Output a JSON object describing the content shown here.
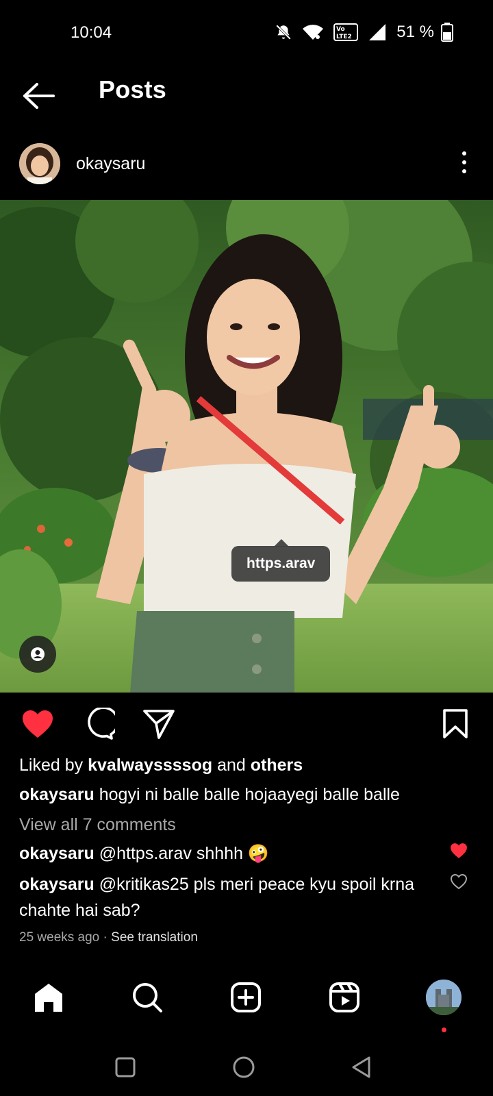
{
  "status_bar": {
    "time": "10:04",
    "battery_percent": "51 %",
    "icons": [
      "mute-icon",
      "wifi-icon",
      "volte-icon",
      "signal-icon",
      "battery-icon"
    ],
    "volte_label": "Vo LTE2"
  },
  "header": {
    "title": "Posts",
    "back_icon": "arrow-left-icon"
  },
  "post": {
    "username": "okaysaru",
    "tag_label": "https.arav",
    "liked": true,
    "likes_prefix": "Liked by ",
    "likes_user": "kvalwayssssog",
    "likes_middle": " and ",
    "likes_suffix": "others",
    "caption_user": "okaysaru",
    "caption_text": "hogyi ni balle balle hojaayegi balle balle",
    "view_comments": "View all 7 comments",
    "comments": [
      {
        "user": "okaysaru",
        "text": "@https.arav shhhh 🤪",
        "liked": true
      },
      {
        "user": "okaysaru",
        "text": "@kritikas25 pls meri peace kyu spoil krna chahte hai sab?",
        "liked": false
      }
    ],
    "time_ago": "25 weeks ago",
    "separator": "·",
    "see_translation": "See translation"
  },
  "bottom_nav": {
    "items": [
      "home-icon",
      "search-icon",
      "create-icon",
      "reels-icon",
      "profile-avatar"
    ],
    "has_notification_dot": true
  },
  "system_nav": {
    "items": [
      "recents-icon",
      "home-circle-icon",
      "back-triangle-icon"
    ]
  },
  "colors": {
    "background": "#000000",
    "like_red": "#ff3040",
    "muted_text": "#a8a8a8"
  }
}
